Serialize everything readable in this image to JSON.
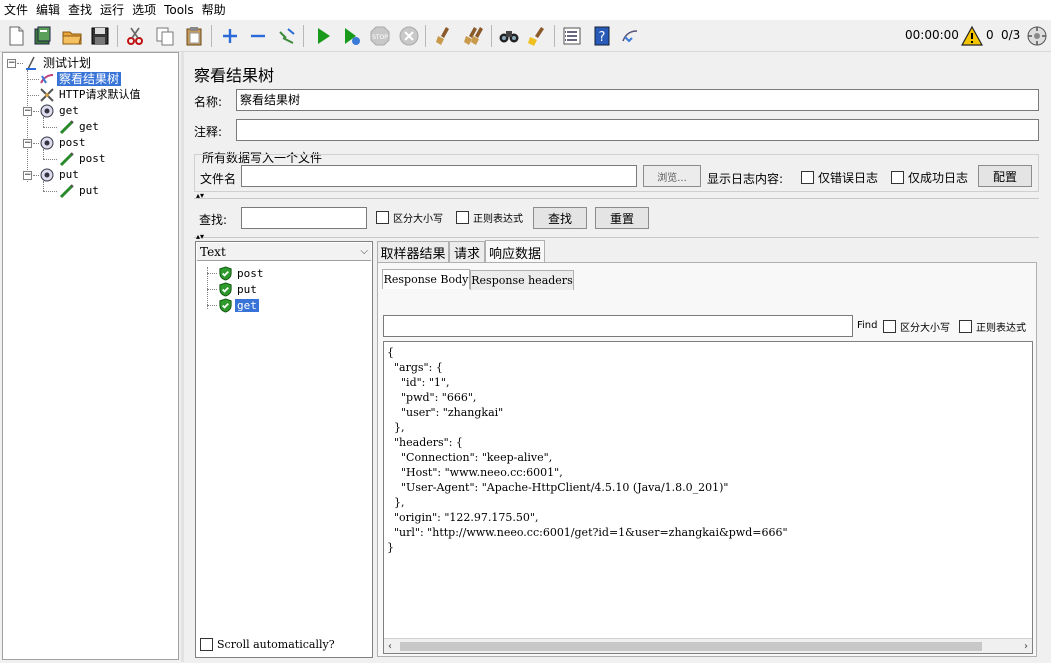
{
  "menu": [
    "文件",
    "编辑",
    "查找",
    "运行",
    "选项",
    "Tools",
    "帮助"
  ],
  "toolbar": {
    "icons": [
      "new-icon",
      "templates-icon",
      "open-icon",
      "save-icon",
      "cut-icon",
      "copy-icon",
      "paste-icon",
      "expand-icon",
      "collapse-icon",
      "toggle-icon",
      "start-icon",
      "start-no-pause-icon",
      "stop-icon",
      "shutdown-icon",
      "clear-icon",
      "clear-all-icon",
      "search-icon",
      "reset-search-icon",
      "function-helper-icon",
      "help-icon",
      "remote-icon"
    ],
    "timer": "00:00:00",
    "warnings": "0",
    "threads": "0/3"
  },
  "tree": {
    "nodes": [
      {
        "label": "测试计划",
        "icon": "test-plan-icon"
      },
      {
        "label": "察看结果树",
        "icon": "listener-icon",
        "selected": true
      },
      {
        "label": "HTTP请求默认值",
        "icon": "config-icon"
      },
      {
        "label": "get",
        "icon": "thread-group-icon"
      },
      {
        "label": "get",
        "icon": "sampler-icon"
      },
      {
        "label": "post",
        "icon": "thread-group-icon"
      },
      {
        "label": "post",
        "icon": "sampler-icon"
      },
      {
        "label": "put",
        "icon": "thread-group-icon"
      },
      {
        "label": "put",
        "icon": "sampler-icon"
      }
    ]
  },
  "panel": {
    "title": "察看结果树",
    "name_label": "名称:",
    "name_value": "察看结果树",
    "comment_label": "注释:",
    "comment_value": "",
    "file_group_title": "所有数据写入一个文件",
    "filename_label": "文件名",
    "filename_value": "",
    "browse_button": "浏览...",
    "log_display_label": "显示日志内容:",
    "errors_only": "仅错误日志",
    "success_only": "仅成功日志",
    "configure_button": "配置"
  },
  "search": {
    "label": "查找:",
    "value": "",
    "case_sensitive": "区分大小写",
    "regex": "正则表达式",
    "search_button": "查找",
    "reset_button": "重置"
  },
  "results": {
    "renderer": "Text",
    "items": [
      {
        "label": "post",
        "status": "success"
      },
      {
        "label": "put",
        "status": "success"
      },
      {
        "label": "get",
        "status": "success",
        "selected": true
      }
    ],
    "scroll_auto": "Scroll automatically?"
  },
  "detail": {
    "tabs": [
      "取样器结果",
      "请求",
      "响应数据"
    ],
    "active_tab": "响应数据",
    "subtabs": [
      "Response Body",
      "Response headers"
    ],
    "active_subtab": "Response Body",
    "find_label": "Find",
    "find_case": "区分大小写",
    "find_regex": "正则表达式",
    "body": "{\n  \"args\": {\n    \"id\": \"1\",\n    \"pwd\": \"666\",\n    \"user\": \"zhangkai\"\n  },\n  \"headers\": {\n    \"Connection\": \"keep-alive\",\n    \"Host\": \"www.neeo.cc:6001\",\n    \"User-Agent\": \"Apache-HttpClient/4.5.10 (Java/1.8.0_201)\"\n  },\n  \"origin\": \"122.97.175.50\",\n  \"url\": \"http://www.neeo.cc:6001/get?id=1&user=zhangkai&pwd=666\"\n}"
  },
  "colors": {
    "selection": "#3874d8",
    "success_green": "#2e9a2e",
    "warning_yellow": "#f5c400",
    "run_green": "#1a9a1a"
  }
}
